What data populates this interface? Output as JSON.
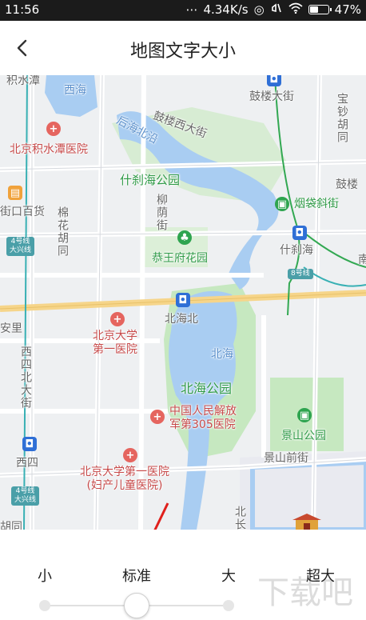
{
  "status_bar": {
    "time": "11:56",
    "network_speed": "4.34K/s",
    "battery_percent": "47%",
    "battery_level": 0.47
  },
  "header": {
    "title": "地图文字大小"
  },
  "map": {
    "labels": {
      "jishuitan": "积水潭",
      "xihai": "西海",
      "gulou_xidajie": "鼓楼西大街",
      "gulou_dajie": "鼓楼大街",
      "baochao_hutong": "宝钞胡同",
      "houhai_beiyan": "后海北沿",
      "beijing_jishuitan_hospital": "北京积水潭医院",
      "shichahai_park": "什刹海公园",
      "liuyin_jie": "柳荫街",
      "yandai_xiejie": "烟袋斜街",
      "gulou_right": "鼓楼",
      "jiekou_baihuo": "街口百货",
      "line4_daxing_1": "4号线\n大兴线",
      "mianhua_hutong": "棉花胡同",
      "gongwangfu_garden": "恭王府花园",
      "shichahai": "什刹海",
      "line8": "8号线",
      "nan_edge": "南",
      "anli_edge": "安里",
      "beihaibei": "北海北",
      "pku_first_hospital": "北京大学\n第一医院",
      "beihai": "北海",
      "xisi_beidajie": "西四北大街",
      "beihai_park": "北海公园",
      "pla_305_hospital": "中国人民解放\n军第305医院",
      "jingshan_park": "景山公园",
      "xisi": "西四",
      "jingshan_qianjie": "景山前街",
      "pku_first_hospital_women": "北京大学第一医院\n(妇产儿童医院)",
      "line4_daxing_2": "4号线\n大兴线",
      "hutong_bottom": "胡同",
      "bei_chang": "北长"
    }
  },
  "font_size": {
    "options": [
      "小",
      "标准",
      "大",
      "超大"
    ],
    "selected_index": 1
  },
  "colors": {
    "water": "#a9cdf2",
    "park": "#c6e8c0",
    "road_major": "#f6d58a",
    "poi_red": "#e5655f",
    "poi_green": "#2ea44f",
    "subway_blue": "#2f6fd6",
    "arrow_red": "#e0201c"
  }
}
